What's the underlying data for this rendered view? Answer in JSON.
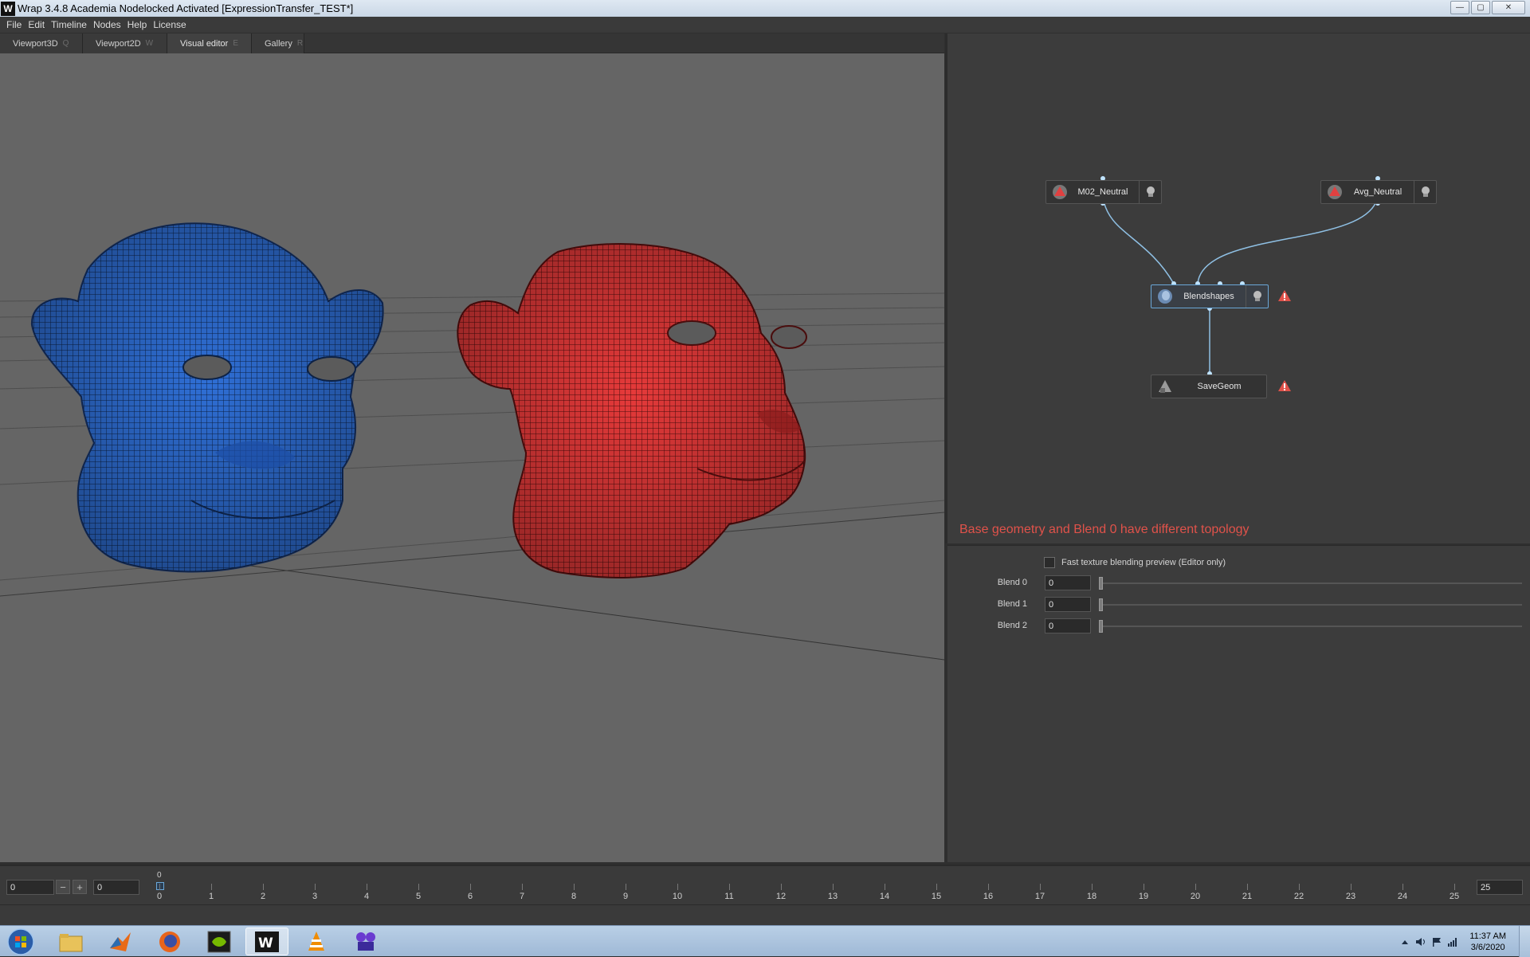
{
  "window": {
    "title": "Wrap 3.4.8 Academia Nodelocked Activated [ExpressionTransfer_TEST*]",
    "logo_letter": "W",
    "buttons": {
      "minimize": "—",
      "maximize": "▢",
      "close": "✕"
    }
  },
  "menu": [
    "File",
    "Edit",
    "Timeline",
    "Nodes",
    "Help",
    "License"
  ],
  "tabs": [
    {
      "label": "Viewport3D",
      "key": "Q"
    },
    {
      "label": "Viewport2D",
      "key": "W"
    },
    {
      "label": "Visual editor",
      "key": "E"
    },
    {
      "label": "Gallery",
      "key": "R"
    }
  ],
  "viewport": {
    "models": [
      {
        "name": "blue-head",
        "color": "#2f6fd6"
      },
      {
        "name": "red-head",
        "color": "#e63a3a"
      }
    ],
    "background": "#656565"
  },
  "nodes": {
    "m02_neutral": {
      "label": "M02_Neutral",
      "icon": "geometry-icon"
    },
    "avg_neutral": {
      "label": "Avg_Neutral",
      "icon": "geometry-icon"
    },
    "blendshapes": {
      "label": "Blendshapes",
      "icon": "head-icon",
      "warning": true
    },
    "savegeom": {
      "label": "SaveGeom",
      "icon": "save-icon",
      "warning": true
    }
  },
  "error_message": "Base geometry and Blend 0 have different topology",
  "properties": {
    "fast_texture_label": "Fast texture blending preview (Editor only)",
    "fast_texture_checked": false,
    "blends": [
      {
        "label": "Blend 0",
        "value": "0"
      },
      {
        "label": "Blend 1",
        "value": "0"
      },
      {
        "label": "Blend 2",
        "value": "0"
      }
    ]
  },
  "timeline": {
    "start": "0",
    "minus": "−",
    "plus": "+",
    "current": "0",
    "end": "25",
    "cursor_frame": "0",
    "ticks": [
      "0",
      "1",
      "2",
      "3",
      "4",
      "5",
      "6",
      "7",
      "8",
      "9",
      "10",
      "11",
      "12",
      "13",
      "14",
      "15",
      "16",
      "17",
      "18",
      "19",
      "20",
      "21",
      "22",
      "23",
      "24",
      "25"
    ]
  },
  "taskbar": {
    "apps": [
      "windows-start",
      "file-explorer",
      "matlab",
      "firefox",
      "nvidia",
      "wrap3",
      "vlc",
      "video-app"
    ],
    "active_app": "wrap3",
    "clock_time": "11:37 AM",
    "clock_date": "3/6/2020"
  },
  "colors": {
    "accent": "#6aa7d8",
    "error": "#e0524a",
    "blue_model": "#2f6fd6",
    "red_model": "#e63a3a"
  }
}
